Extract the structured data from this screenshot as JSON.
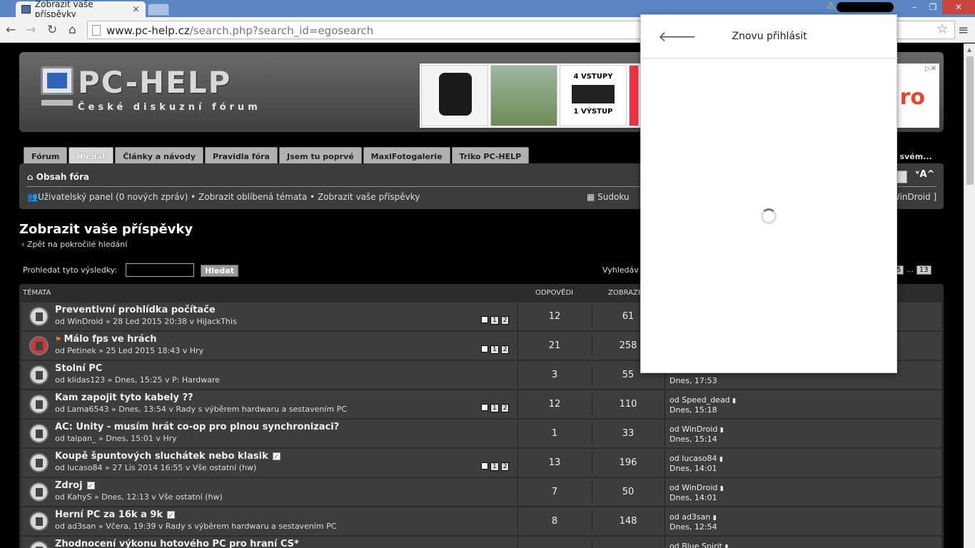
{
  "browser": {
    "tab_title": "Zobrazit vaše příspěvky",
    "url_host": "www.pc-help.cz",
    "url_path": "/search.php?search_id=egosearch"
  },
  "header": {
    "logo_text": "PC-HELP",
    "logo_sub": "České diskuzní fórum",
    "ad_3_top": "4 VSTUPY",
    "ad_3_bottom": "1 VÝSTUP",
    "ad_brand_partial": "ro"
  },
  "nav_tabs": [
    "Fórum",
    "Hledat",
    "Články a návody",
    "Pravidla fóra",
    "Jsem tu poprvé",
    "MaxiFotogalerie",
    "Triko PC-HELP"
  ],
  "tagline_partial": "e po svém...",
  "navbar": {
    "home": "Obsah fóra",
    "links": "Uživatelský panel (0 nových zpráv) • Zobrazit oblíbená témata • Zobrazit vaše příspěvky",
    "sudoku": "Sudoku",
    "user_partial": "WinDroid ]",
    "aa": "ᵛA^"
  },
  "page": {
    "title": "Zobrazit vaše příspěvky",
    "back_link": "Zpět na pokročilé hledání",
    "search_label": "Prohledat tyto výsledky:",
    "search_button": "Hledat",
    "found_partial": "Vyhledáv",
    "pager": [
      "5",
      "...",
      "13"
    ]
  },
  "table": {
    "col_topics": "TÉMATA",
    "col_replies": "ODPOVĚDI",
    "col_views": "ZOBRAZE",
    "rows": [
      {
        "title": "Preventivní prohlídka počítače",
        "by": "od WinDroid » 28 Led 2015 20:38 v HiJackThis",
        "replies": "12",
        "views": "61",
        "last_by": "",
        "last_time": ""
      },
      {
        "title": "Málo fps ve hrách",
        "by": "od Petinek » 25 Led 2015 18:43 v Hry",
        "replies": "21",
        "views": "258",
        "last_by": "",
        "last_time": ""
      },
      {
        "title": "Stolní PC",
        "by": "od klidas123 » Dnes, 15:25 v P: Hardware",
        "replies": "3",
        "views": "55",
        "last_by": "",
        "last_time": "Dnes, 17:53"
      },
      {
        "title": "Kam zapojit tyto kabely ??",
        "by": "od Lama6543 » Dnes, 13:54 v Rady s výběrem hardwaru a sestavením PC",
        "replies": "12",
        "views": "110",
        "last_by": "od Speed_dead",
        "last_time": "Dnes, 15:18"
      },
      {
        "title": "AC: Unity - musím hrát co-op pro plnou synchronizaci?",
        "by": "od taipan_ » Dnes, 15:01 v Hry",
        "replies": "1",
        "views": "33",
        "last_by": "od WinDroid",
        "last_time": "Dnes, 15:14"
      },
      {
        "title": "Koupě špuntových sluchátek nebo klasik",
        "by": "od lucaso84 » 27 Lis 2014 16:55 v Vše ostatní (hw)",
        "replies": "13",
        "views": "196",
        "last_by": "od lucaso84",
        "last_time": "Dnes, 14:01"
      },
      {
        "title": "Zdroj",
        "by": "od KahyS » Dnes, 12:13 v Vše ostatní (hw)",
        "replies": "7",
        "views": "50",
        "last_by": "od WinDroid",
        "last_time": "Dnes, 14:01"
      },
      {
        "title": "Herní PC za 16k a 9k",
        "by": "od ad3san » Včera, 19:39 v Rady s výběrem hardwaru a sestavením PC",
        "replies": "8",
        "views": "148",
        "last_by": "od ad3san",
        "last_time": "Dnes, 12:54"
      },
      {
        "title": "Zhodnocení výkonu hotového PC pro hraní CS*",
        "by": "",
        "replies": "",
        "views": "",
        "last_by": "od Blue Spirit",
        "last_time": ""
      }
    ]
  },
  "popup": {
    "title": "Znovu přihlásit"
  }
}
